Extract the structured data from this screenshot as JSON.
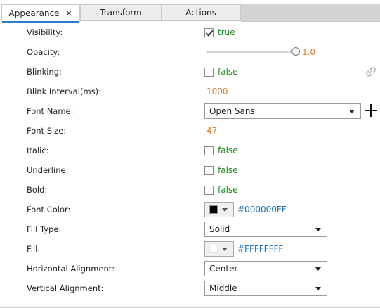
{
  "tabs": [
    {
      "label": "Appearance",
      "active": true,
      "close": "×"
    },
    {
      "label": "Transform",
      "active": false
    },
    {
      "label": "Actions",
      "active": false
    }
  ],
  "properties": {
    "visibility": {
      "label": "Visibility:",
      "checked": true,
      "value": "true"
    },
    "opacity": {
      "label": "Opacity:",
      "value": "1.0",
      "level": 1.0
    },
    "blinking": {
      "label": "Blinking:",
      "checked": false,
      "value": "false"
    },
    "blink_interval": {
      "label": "Blink Interval(ms):",
      "value": "1000"
    },
    "font_name": {
      "label": "Font Name:",
      "value": "Open Sans"
    },
    "font_size": {
      "label": "Font Size:",
      "value": "47"
    },
    "italic": {
      "label": "Italic:",
      "checked": false,
      "value": "false"
    },
    "underline": {
      "label": "Underline:",
      "checked": false,
      "value": "false"
    },
    "bold": {
      "label": "Bold:",
      "checked": false,
      "value": "false"
    },
    "font_color": {
      "label": "Font Color:",
      "value": "#000000FF",
      "swatch": "#000000"
    },
    "fill_type": {
      "label": "Fill Type:",
      "value": "Solid"
    },
    "fill": {
      "label": "Fill:",
      "value": "#FFFFFFFF",
      "swatch": "#ffffff"
    },
    "h_align": {
      "label": "Horizontal Alignment:",
      "value": "Center"
    },
    "v_align": {
      "label": "Vertical Alignment:",
      "value": "Middle"
    }
  },
  "colors": {
    "accent": "#2a7fc9",
    "bool": "#1e8a1e",
    "number": "#e07b22",
    "hex": "#1f6fb5"
  }
}
